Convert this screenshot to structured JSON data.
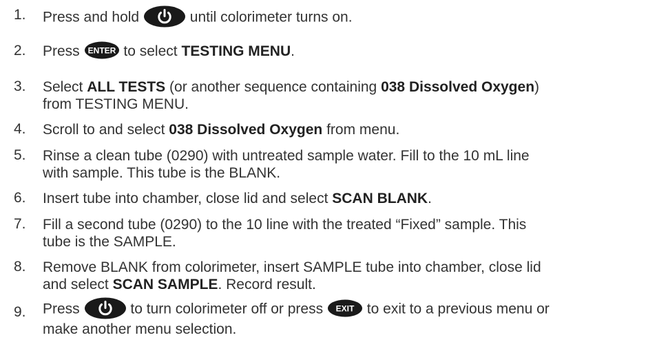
{
  "steps": [
    {
      "number": "1.",
      "parts": [
        "Press and hold",
        "until colorimeter turns on."
      ],
      "icon": "power-button-icon"
    },
    {
      "number": "2.",
      "parts": [
        "Press",
        "to select",
        "TESTING MENU",
        "."
      ],
      "icon": "enter-button-icon",
      "icon_label": "ENTER"
    },
    {
      "number": "3.",
      "parts": [
        "Select",
        "ALL TESTS",
        "(or another sequence containing",
        "038 Dissolved Oxygen",
        ")",
        "from TESTING MENU."
      ]
    },
    {
      "number": "4.",
      "parts": [
        "Scroll to and select",
        "038 Dissolved Oxygen",
        "from menu."
      ]
    },
    {
      "number": "5.",
      "parts": [
        "Rinse a clean tube (0290) with untreated sample water. Fill to the 10 mL line",
        "with sample. This tube is the BLANK."
      ]
    },
    {
      "number": "6.",
      "parts": [
        "Insert tube into chamber, close lid and select",
        "SCAN BLANK",
        "."
      ]
    },
    {
      "number": "7.",
      "parts": [
        "Fill a second tube (0290) to the 10 line with the treated “Fixed” sample. This",
        "tube is the SAMPLE."
      ]
    },
    {
      "number": "8.",
      "parts": [
        "Remove BLANK from colorimeter, insert SAMPLE tube into chamber, close lid",
        "and select",
        "SCAN SAMPLE",
        ". Record result."
      ]
    },
    {
      "number": "9.",
      "parts": [
        "Press",
        "to turn colorimeter off or press",
        "to exit to a previous menu or",
        "make another menu selection."
      ],
      "icons": [
        "power-button-icon",
        "exit-button-icon"
      ],
      "icon_label": "EXIT"
    }
  ],
  "colors": {
    "text": "#333333",
    "icon": "#1a1a1a"
  }
}
